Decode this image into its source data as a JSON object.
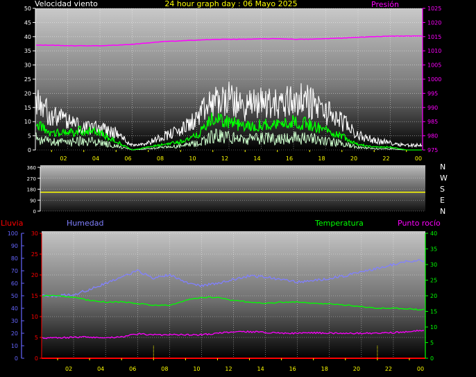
{
  "header": {
    "title": "24 hour graph day : 06 Mayo 2025",
    "wind_label": "Velocidad viento",
    "pressure_label": "Presión"
  },
  "direction_labels": [
    "N",
    "W",
    "S",
    "E",
    "N"
  ],
  "bottom_labels": {
    "rain": "Lluvia",
    "humidity": "Humedad",
    "temperature": "Temperatura",
    "dewpoint": "Punto rocío"
  },
  "colors": {
    "title": "#ffff00",
    "wind_gust": "#ffffff",
    "wind_avg": "#00ff00",
    "wind_low": "#ccffcc",
    "pressure": "#ff00ff",
    "direction": "#ffff00",
    "rain": "#ff0000",
    "humidity": "#8080ff",
    "temperature": "#00ff00",
    "dewpoint": "#ff00ff",
    "axis_blue": "#6666ff",
    "axis_green": "#00ff00",
    "axis_red": "#ff0000"
  },
  "chart_data": [
    {
      "id": "wind_pressure",
      "type": "line",
      "title": "24 hour graph day : 06 Mayo 2025",
      "x_tick_labels": [
        "02",
        "04",
        "06",
        "08",
        "10",
        "12",
        "14",
        "16",
        "18",
        "20",
        "22",
        "00"
      ],
      "x_tick_hours": [
        2,
        4,
        6,
        8,
        10,
        12,
        14,
        16,
        18,
        20,
        22,
        24
      ],
      "xlim": [
        0,
        24
      ],
      "ylim_left": [
        0,
        50
      ],
      "y_ticks_left": [
        0,
        5,
        10,
        15,
        20,
        25,
        30,
        35,
        40,
        45,
        50
      ],
      "ylim_right": [
        975,
        1025
      ],
      "y_ticks_right": [
        975,
        980,
        985,
        990,
        995,
        1000,
        1005,
        1010,
        1015,
        1020,
        1025
      ],
      "grid": true,
      "series": [
        {
          "name": "Velocidad viento",
          "axis": "left",
          "kind": "gust",
          "x": [
            0,
            1,
            2,
            3,
            4,
            5,
            6,
            7,
            8,
            9,
            10,
            11,
            12,
            13,
            14,
            15,
            16,
            17,
            18,
            19,
            20,
            21,
            22,
            23,
            24
          ],
          "y": [
            20,
            14,
            12,
            10,
            9,
            7,
            2,
            3,
            6,
            8,
            13,
            20,
            21,
            18,
            20,
            19,
            21,
            20,
            16,
            12,
            6,
            4,
            3,
            2,
            2
          ]
        },
        {
          "name": "Velocidad viento",
          "axis": "left",
          "kind": "average",
          "x": [
            0,
            1,
            2,
            3,
            4,
            5,
            6,
            7,
            8,
            9,
            10,
            11,
            12,
            13,
            14,
            15,
            16,
            17,
            18,
            19,
            20,
            21,
            22,
            23,
            24
          ],
          "y": [
            9,
            6,
            6,
            7,
            6,
            3,
            0,
            1,
            2,
            3,
            5,
            11,
            10,
            8,
            9,
            9,
            10,
            9,
            7,
            5,
            2,
            1,
            1,
            0,
            0
          ]
        },
        {
          "name": "Presión",
          "axis": "right",
          "kind": "pressure",
          "x": [
            0,
            1,
            2,
            3,
            4,
            5,
            6,
            7,
            8,
            9,
            10,
            11,
            12,
            13,
            14,
            15,
            16,
            17,
            18,
            19,
            20,
            21,
            22,
            23,
            24
          ],
          "y": [
            1012.0,
            1012.0,
            1011.8,
            1011.8,
            1011.8,
            1012.0,
            1012.3,
            1012.8,
            1013.3,
            1013.5,
            1013.8,
            1014.0,
            1014.1,
            1014.1,
            1014.2,
            1014.3,
            1014.1,
            1014.1,
            1014.3,
            1014.5,
            1014.8,
            1015.0,
            1015.2,
            1015.2,
            1015.3
          ]
        }
      ]
    },
    {
      "id": "wind_direction",
      "type": "line",
      "xlim": [
        0,
        24
      ],
      "ylim": [
        0,
        360
      ],
      "y_ticks": [
        0,
        90,
        180,
        270,
        360
      ],
      "grid": true,
      "series": [
        {
          "name": "direction",
          "x": [
            0,
            24
          ],
          "y": [
            155,
            155
          ]
        }
      ]
    },
    {
      "id": "temp_hum",
      "type": "line",
      "x_tick_labels": [
        "02",
        "04",
        "06",
        "08",
        "10",
        "12",
        "14",
        "16",
        "18",
        "20",
        "22",
        "00"
      ],
      "x_tick_hours": [
        2,
        4,
        6,
        8,
        10,
        12,
        14,
        16,
        18,
        20,
        22,
        24
      ],
      "xlim": [
        0,
        24
      ],
      "ylim_humidity": [
        0,
        100
      ],
      "y_ticks_humidity": [
        0,
        10,
        20,
        30,
        40,
        50,
        60,
        70,
        80,
        90,
        100
      ],
      "ylim_rain": [
        0,
        30
      ],
      "y_ticks_rain": [
        0,
        5,
        10,
        15,
        20,
        25,
        30
      ],
      "ylim_temperature": [
        0,
        40
      ],
      "y_ticks_temperature": [
        0,
        5,
        10,
        15,
        20,
        25,
        30,
        35,
        40
      ],
      "grid": true,
      "series": [
        {
          "name": "Humedad",
          "axis": "humidity",
          "x": [
            0,
            1,
            2,
            3,
            4,
            5,
            6,
            7,
            8,
            9,
            10,
            11,
            12,
            13,
            14,
            15,
            16,
            17,
            18,
            19,
            20,
            21,
            22,
            23,
            24
          ],
          "y": [
            50,
            50,
            51,
            55,
            60,
            65,
            70,
            64,
            67,
            61,
            58,
            60,
            63,
            66,
            65,
            63,
            61,
            62,
            64,
            66,
            69,
            72,
            75,
            78,
            78
          ]
        },
        {
          "name": "Temperatura",
          "axis": "temperature",
          "x": [
            0,
            1,
            2,
            3,
            4,
            5,
            6,
            7,
            8,
            9,
            10,
            11,
            12,
            13,
            14,
            15,
            16,
            17,
            18,
            19,
            20,
            21,
            22,
            23,
            24
          ],
          "y": [
            20,
            20,
            19.5,
            18.5,
            18,
            18,
            17.5,
            17,
            17,
            18.5,
            19.5,
            19.5,
            18.5,
            18,
            17.5,
            18,
            18,
            17.5,
            17.5,
            17,
            16.5,
            16,
            16,
            15.8,
            15.5
          ]
        },
        {
          "name": "Punto rocío",
          "axis": "temperature",
          "x": [
            0,
            1,
            2,
            3,
            4,
            5,
            6,
            7,
            8,
            9,
            10,
            11,
            12,
            13,
            14,
            15,
            16,
            17,
            18,
            19,
            20,
            21,
            22,
            23,
            24
          ],
          "y": [
            6.5,
            6.5,
            6.7,
            6.8,
            6.5,
            6.8,
            7.8,
            7.5,
            7.5,
            7.5,
            7.5,
            8.0,
            8.5,
            8.5,
            8.3,
            8.0,
            8.0,
            8.2,
            8.0,
            8.0,
            8.0,
            8.0,
            8.2,
            8.5,
            9
          ]
        },
        {
          "name": "Lluvia",
          "axis": "rain",
          "x": [
            0,
            24
          ],
          "y": [
            0,
            0
          ]
        }
      ]
    }
  ]
}
